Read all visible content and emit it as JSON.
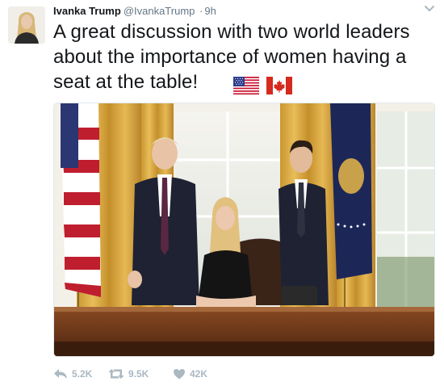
{
  "tweet": {
    "author_name": "Ivanka Trump",
    "author_handle": "@IvankaTrump",
    "separator": "·",
    "timestamp": "9h",
    "text": "A great discussion with two world leaders about the importance of women having a seat at the table!",
    "flags": [
      "flag-us-icon",
      "flag-canada-icon"
    ],
    "photo": "photo of three people in an oval office"
  },
  "actions": {
    "reply_count": "5.2K",
    "retweet_count": "9.5K",
    "like_count": "42K"
  },
  "icons": {
    "reply": "reply-icon",
    "retweet": "retweet-icon",
    "like": "heart-icon",
    "more": "chevron-down-icon"
  },
  "colors": {
    "text": "#14171a",
    "muted": "#657786",
    "action_gray": "#aab8c2"
  }
}
